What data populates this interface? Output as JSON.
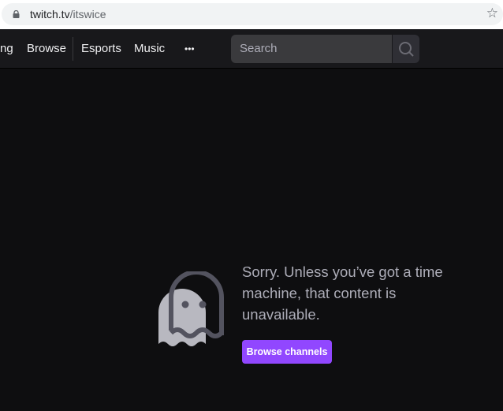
{
  "browser": {
    "url_domain": "twitch.tv",
    "url_path": "/itswice",
    "lock_icon": "lock-icon",
    "bookmark_icon": "star-icon"
  },
  "nav": {
    "items": [
      {
        "label": "ng"
      },
      {
        "label": "Browse"
      },
      {
        "label": "Esports"
      },
      {
        "label": "Music"
      },
      {
        "label": "•••"
      }
    ],
    "search_placeholder": "Search"
  },
  "main": {
    "message": "Sorry. Unless you’ve got a time machine, that content is unavailable.",
    "button_label": "Browse channels",
    "accent": "#9147ff"
  }
}
